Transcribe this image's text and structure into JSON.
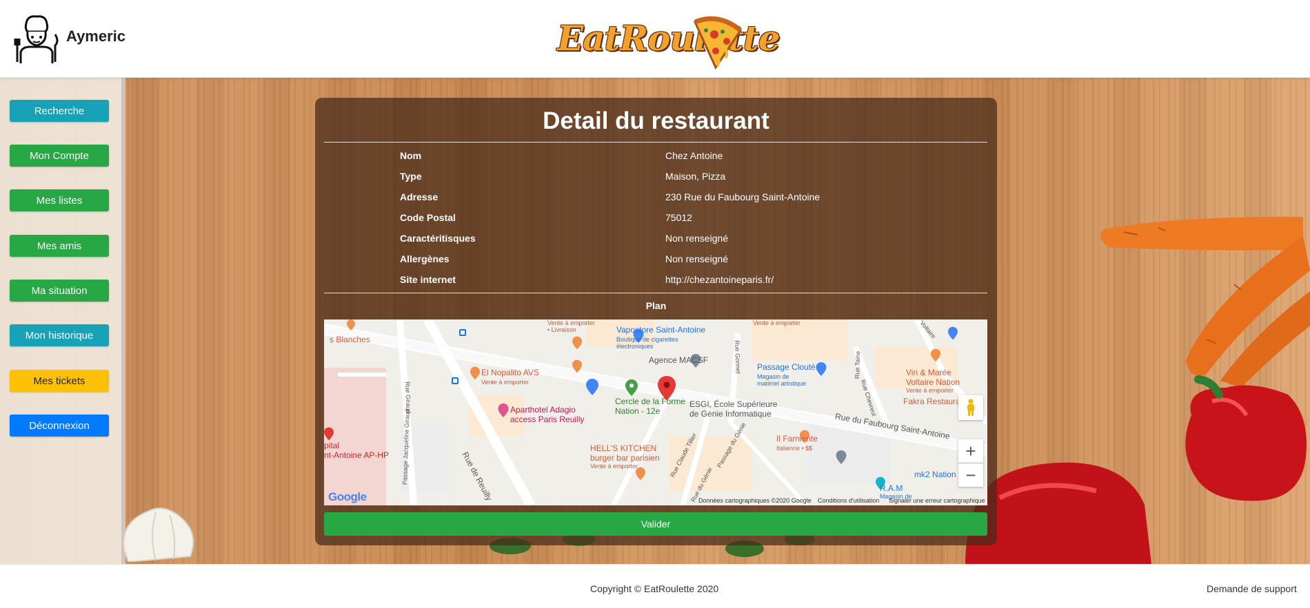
{
  "header": {
    "username": "Aymeric",
    "logo_text": "EatRoulette"
  },
  "sidebar": {
    "items": [
      {
        "label": "Recherche",
        "color": "#17a2b8"
      },
      {
        "label": "Mon Compte",
        "color": "#28a745"
      },
      {
        "label": "Mes listes",
        "color": "#28a745"
      },
      {
        "label": "Mes amis",
        "color": "#28a745"
      },
      {
        "label": "Ma situation",
        "color": "#28a745"
      },
      {
        "label": "Mon historique",
        "color": "#17a2b8"
      },
      {
        "label": "Mes tickets",
        "color": "#ffc107"
      },
      {
        "label": "Déconnexion",
        "color": "#007bff"
      }
    ]
  },
  "detail": {
    "title": "Detail du restaurant",
    "rows": [
      {
        "label": "Nom",
        "value": "Chez Antoine"
      },
      {
        "label": "Type",
        "value": "Maison, Pizza"
      },
      {
        "label": "Adresse",
        "value": "230 Rue du Faubourg Saint-Antoine"
      },
      {
        "label": "Code Postal",
        "value": "75012"
      },
      {
        "label": "Caractéritisques",
        "value": "Non renseigné"
      },
      {
        "label": "Allergènes",
        "value": "Non renseigné"
      },
      {
        "label": "Site internet",
        "value": "http://chezantoineparis.fr/"
      }
    ],
    "plan_label": "Plan",
    "validate_label": "Valider"
  },
  "map": {
    "places": {
      "blanches": "s Blanches",
      "vente_top1": "Vente à emporter",
      "livraison": "• Livraison",
      "vente_top2": "Vente à emporter",
      "vapostore": "Vapostore Saint-Antoine",
      "vapostore_sub1": "Boutique de cigarettes",
      "vapostore_sub2": "électroniques",
      "macsf": "Agence MACSF",
      "passage_cloute": "Passage Clouté",
      "passage_cloute_sub1": "Magasin de",
      "passage_cloute_sub2": "matériel artistique",
      "vin_maree": "Vin & Marée",
      "vin_maree_2": "Voltaire Nation",
      "vin_maree_sub": "Vente à emporter",
      "nopalito": "El Nopalito AVS",
      "nopalito_sub": "Vente à emporter",
      "cercle": "Cercle de la Forme",
      "cercle_2": "Nation - 12e",
      "esgi": "ESGI, École Supérieure",
      "esgi_2": "de Génie Informatique",
      "fakra": "Fakra Restaurant Li",
      "adagio": "Aparthotel Adagio",
      "adagio_2": "access Paris Reuilly",
      "hells": "HELL'S KITCHEN",
      "hells_2": "burger bar parisien",
      "hells_sub": "Vente à emporter",
      "farniente": "Il Farniente",
      "farniente_sub": "Italienne • $$",
      "hopital": "pital",
      "hopital_2": "nt-Antoine AP-HP",
      "mk2": "mk2 Nation",
      "ram": "R.A.M",
      "magasin": "Magasin de"
    },
    "streets": {
      "faubourg": "Rue du Faubourg Saint-Antoine",
      "reuilly": "Rue de Reuilly",
      "jacqueline": "Passage Jacqueline Giraud",
      "tillier": "Rue Claude Tillier",
      "genie": "Passage du Génie",
      "genie2": "Rue du Génie",
      "chevreul": "Rue Chevreul",
      "gonnet": "Rue Gonnet",
      "taine": "Rue Taine",
      "voltaire": "Voltaire",
      "giraud": "Rue Giraud"
    },
    "brand": "Google",
    "footer": {
      "data": "Données cartographiques ©2020 Google",
      "terms": "Conditions d'utilisation",
      "report": "Signaler une erreur cartographique"
    },
    "zoom_in": "+",
    "zoom_out": "−"
  },
  "footer": {
    "copyright": "Copyright © EatRoulette 2020",
    "support": "Demande de support"
  }
}
